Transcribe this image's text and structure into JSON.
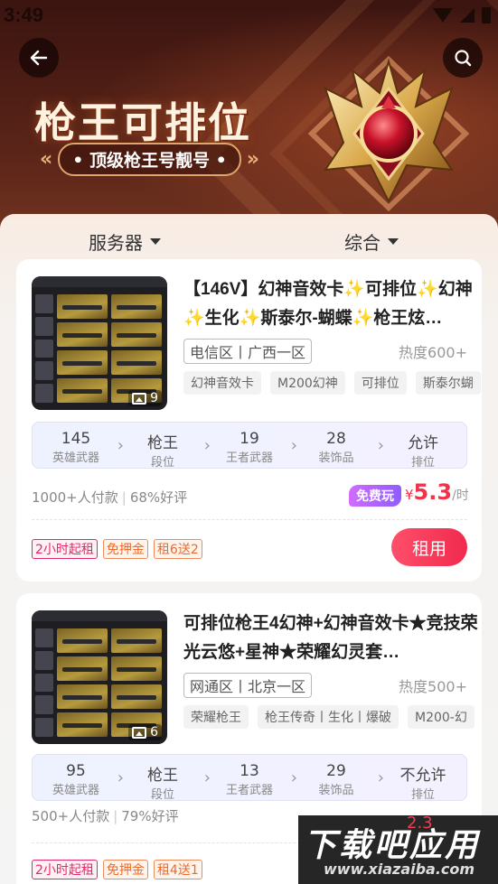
{
  "status_bar": {
    "time": "3:49"
  },
  "hero": {
    "title": "枪王可排位",
    "subtitle": "• 顶级枪王号靓号 •"
  },
  "filters": {
    "server_label": "服务器",
    "sort_label": "综合"
  },
  "listings": [
    {
      "title": "【146V】幻神音效卡✨可排位✨幻神✨生化✨斯泰尔-蝴蝶✨枪王炫…",
      "region": "电信区丨广西一区",
      "heat": "热度600+",
      "image_count": "9",
      "tags": [
        "幻神音效卡",
        "M200幻神",
        "可排位",
        "斯泰尔蝴"
      ],
      "stats": [
        {
          "value": "145",
          "label": "英雄武器"
        },
        {
          "value": "枪王",
          "label": "段位"
        },
        {
          "value": "19",
          "label": "王者武器"
        },
        {
          "value": "28",
          "label": "装饰品"
        },
        {
          "value": "允许",
          "label": "排位"
        }
      ],
      "sold": "1000+人付款",
      "rating": "68%好评",
      "free_badge": "免费玩",
      "price_symbol": "¥",
      "price": "5.3",
      "price_unit": "/时",
      "badges": [
        "2小时起租",
        "免押金",
        "租6送2"
      ],
      "rent_label": "租用"
    },
    {
      "title": "可排位枪王4幻神+幻神音效卡★竞技荣光云悠+星神★荣耀幻灵套…",
      "region": "网通区丨北京一区",
      "heat": "热度500+",
      "image_count": "6",
      "tags": [
        "荣耀枪王",
        "枪王传奇丨生化丨爆破",
        "M200-幻"
      ],
      "stats": [
        {
          "value": "95",
          "label": "英雄武器"
        },
        {
          "value": "枪王",
          "label": "段位"
        },
        {
          "value": "13",
          "label": "王者武器"
        },
        {
          "value": "29",
          "label": "装饰品"
        },
        {
          "value": "不允许",
          "label": "排位"
        }
      ],
      "sold": "500+人付款",
      "rating": "79%好评",
      "price": "2.3",
      "badges": [
        "2小时起租",
        "免押金",
        "租4送1"
      ]
    }
  ],
  "watermark": {
    "title": "下载吧应用",
    "url": "www.xiazaiba.com"
  },
  "colors": {
    "accent": "#f0334a",
    "hero_bg": "#5a2418",
    "free_badge": "#b066ff"
  }
}
